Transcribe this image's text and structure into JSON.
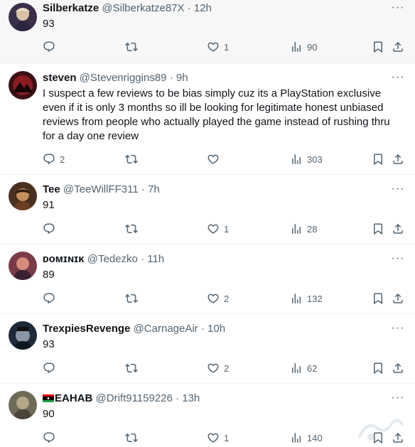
{
  "tweets": [
    {
      "name": "Silberkatze",
      "handle": "@Silberkatze87X",
      "time": "12h",
      "text": "93",
      "replies": "",
      "likes": "1",
      "views": "90"
    },
    {
      "name": "steven",
      "handle": "@Stevenriggins89",
      "time": "9h",
      "text": "I suspect a few reviews to be bias simply cuz its a PlayStation exclusive even if it is only 3 months so ill be looking for legitimate honest unbiased reviews from people who actually played the game instead of rushing thru for a day one review",
      "replies": "2",
      "likes": "",
      "views": "303"
    },
    {
      "name": "Tee",
      "handle": "@TeeWillFF311",
      "time": "7h",
      "text": "91",
      "replies": "",
      "likes": "1",
      "views": "28"
    },
    {
      "name": "ᴅᴏᴍɪɴɪᴋ",
      "handle": "@Tedezko",
      "time": "11h",
      "text": "89",
      "replies": "",
      "likes": "2",
      "views": "132"
    },
    {
      "name": "TrexpiesRevenge",
      "handle": "@CarnageAir",
      "time": "10h",
      "text": "93",
      "replies": "",
      "likes": "2",
      "views": "62"
    },
    {
      "name": "EAHAB",
      "handle": "@Drift91159226",
      "time": "13h",
      "text": "90",
      "replies": "",
      "likes": "1",
      "views": "140"
    }
  ],
  "separator": "·",
  "icons": {
    "reply": "reply-icon",
    "retweet": "retweet-icon",
    "like": "heart-icon",
    "views": "views-icon",
    "bookmark": "bookmark-icon",
    "share": "share-icon",
    "more": "more-icon",
    "flag": "flag-icon"
  },
  "colors": {
    "text": "#0f1419",
    "secondary": "#536471",
    "divider": "#eff3f4",
    "highlight_bg": "#f7f7f7"
  }
}
